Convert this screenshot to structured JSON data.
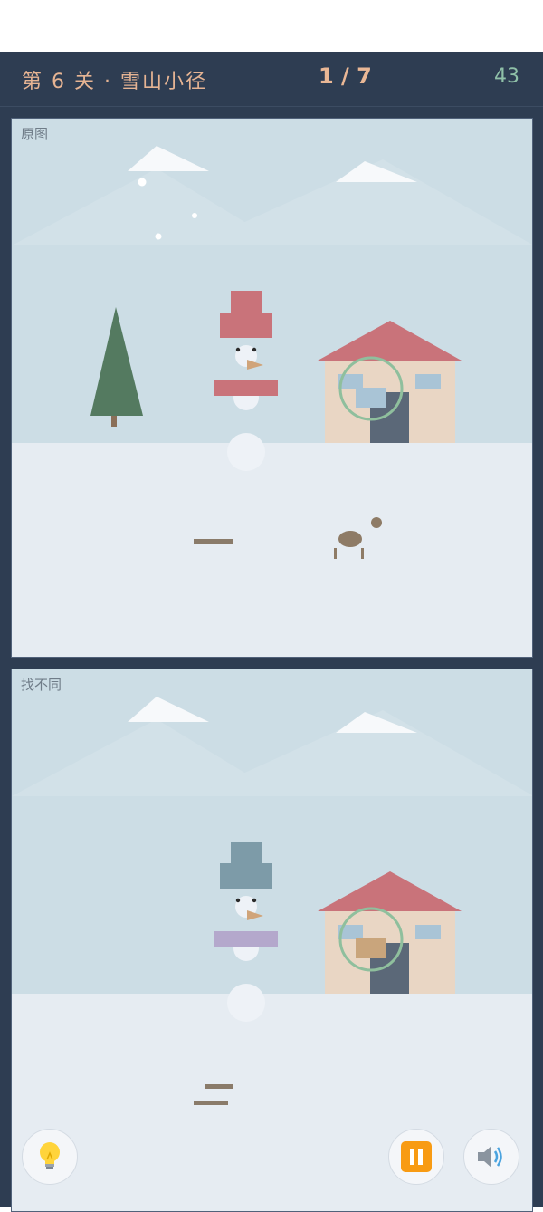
{
  "header": {
    "level_text": "第 6 关 · 雪山小径",
    "progress": "1 / 7",
    "timer": "43"
  },
  "panels": {
    "original_label": "原图",
    "modified_label": "找不同"
  },
  "colors": {
    "app_bg": "#2e3d52",
    "accent_orange": "#e6b493",
    "accent_green": "#8fc0a8",
    "sky": "#ccdde5",
    "ground": "#e6ecf2",
    "hat_original": "#c9737a",
    "hat_modified": "#7d9ba8",
    "scarf_modified": "#b4a8cc",
    "found_circle": "#8fbf9d"
  },
  "controls": {
    "hint_icon": "lightbulb-icon",
    "pause_icon": "pause-icon",
    "sound_icon": "speaker-icon"
  }
}
